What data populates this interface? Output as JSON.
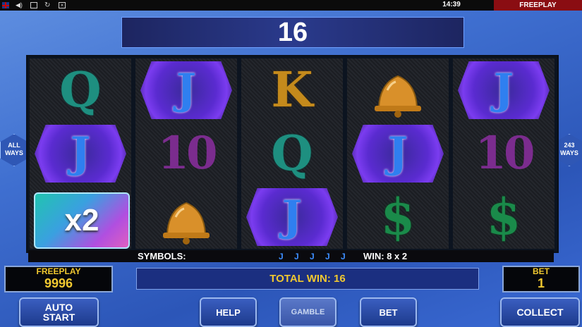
{
  "topbar": {
    "time": "14:39",
    "mode": "FREEPLAY",
    "icons": [
      "flag-uk-icon",
      "sound-icon",
      "fullscreen-icon",
      "refresh-icon",
      "close-icon"
    ]
  },
  "win_display": "16",
  "side": {
    "left_top": "ALL",
    "left_bottom": "WAYS",
    "right_top": "243",
    "right_bottom": "WAYS"
  },
  "reels": [
    [
      "Q",
      "J",
      "x2"
    ],
    [
      "J",
      "10",
      "bell"
    ],
    [
      "K",
      "Q",
      "J"
    ],
    [
      "bell",
      "J",
      "$"
    ],
    [
      "J",
      "10",
      "$"
    ]
  ],
  "symbols_line": {
    "label": "SYMBOLS:",
    "symbols": "J J J J J",
    "win": "WIN: 8 x 2"
  },
  "balance": {
    "label": "FREEPLAY",
    "value": "9996"
  },
  "total_win": "TOTAL WIN: 16",
  "bet": {
    "label": "BET",
    "value": "1"
  },
  "buttons": {
    "auto_line1": "AUTO",
    "auto_line2": "START",
    "help": "HELP",
    "gamble": "GAMBLE",
    "bet": "BET",
    "collect": "COLLECT"
  },
  "colors": {
    "accent": "#f0c830",
    "freeplay_bg": "#8a0d12",
    "highlight": "#5a2bd0"
  }
}
